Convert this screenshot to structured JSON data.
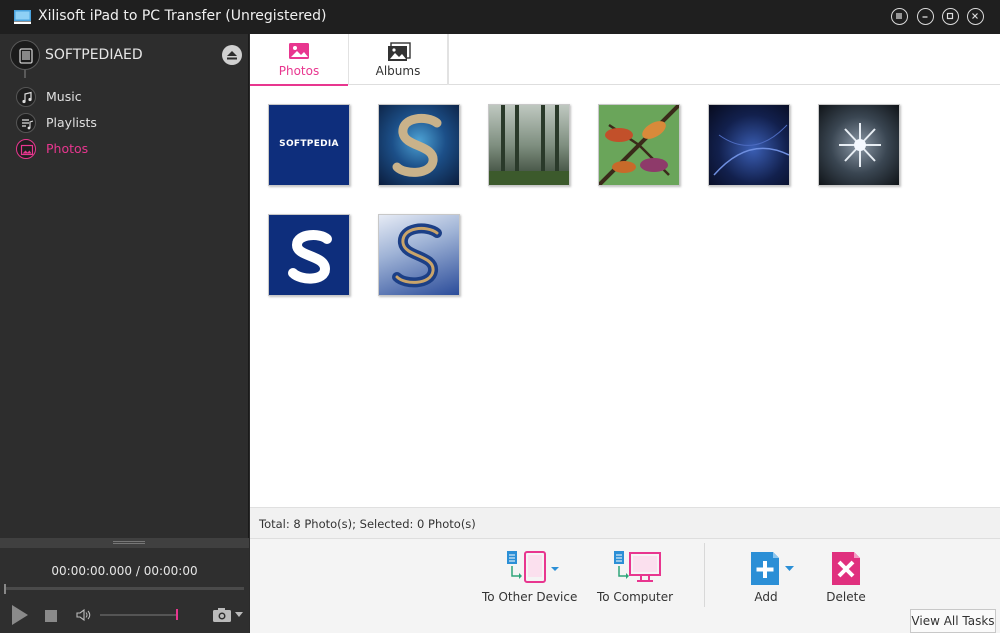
{
  "window": {
    "title": "Xilisoft iPad to PC Transfer (Unregistered)"
  },
  "sidebar": {
    "device_name": "SOFTPEDIAED",
    "items": [
      {
        "label": "Music",
        "icon": "music-note-icon"
      },
      {
        "label": "Playlists",
        "icon": "playlist-icon"
      },
      {
        "label": "Photos",
        "icon": "photo-icon",
        "active": true
      }
    ]
  },
  "player": {
    "time": "00:00:00.000 / 00:00:00",
    "volume_fraction": 1.0
  },
  "tabs": [
    {
      "label": "Photos",
      "active": true
    },
    {
      "label": "Albums",
      "active": false
    }
  ],
  "photos": [
    {
      "caption": "SOFTPEDIA"
    },
    {
      "caption": ""
    },
    {
      "caption": ""
    },
    {
      "caption": ""
    },
    {
      "caption": ""
    },
    {
      "caption": ""
    },
    {
      "caption": ""
    },
    {
      "caption": ""
    }
  ],
  "status": {
    "text": "Total: 8 Photo(s); Selected: 0 Photo(s)"
  },
  "toolbar": {
    "to_other_device": "To Other Device",
    "to_computer": "To Computer",
    "add": "Add",
    "delete": "Delete",
    "view_all_tasks": "View All Tasks"
  },
  "colors": {
    "accent": "#e8368f",
    "add_blue": "#2b8fd6",
    "delete_pink": "#e0307e"
  }
}
